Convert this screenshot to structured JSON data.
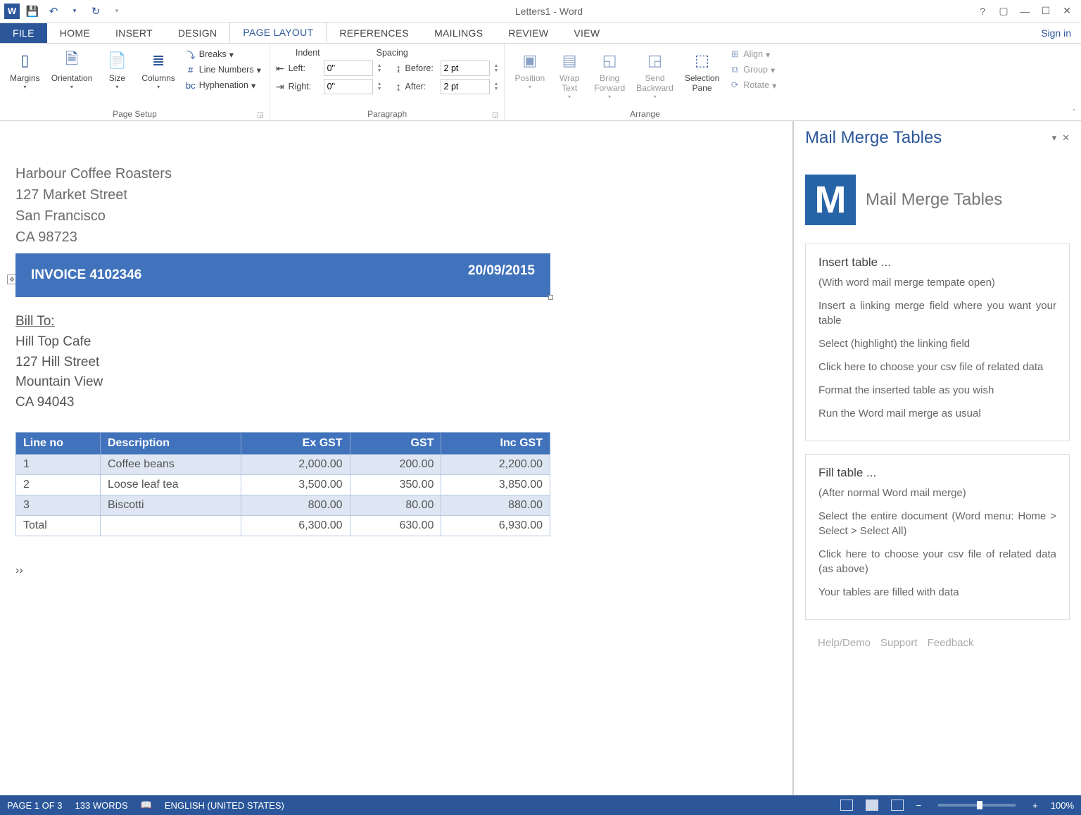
{
  "title": "Letters1 - Word",
  "signin": "Sign in",
  "tabs": [
    "FILE",
    "HOME",
    "INSERT",
    "DESIGN",
    "PAGE LAYOUT",
    "REFERENCES",
    "MAILINGS",
    "REVIEW",
    "VIEW"
  ],
  "active_tab": "PAGE LAYOUT",
  "ribbon": {
    "page_setup": {
      "label": "Page Setup",
      "margins": "Margins",
      "orientation": "Orientation",
      "size": "Size",
      "columns": "Columns",
      "breaks": "Breaks",
      "line_numbers": "Line Numbers",
      "hyphenation": "Hyphenation"
    },
    "paragraph": {
      "label": "Paragraph",
      "indent_head": "Indent",
      "spacing_head": "Spacing",
      "left_lbl": "Left:",
      "right_lbl": "Right:",
      "before_lbl": "Before:",
      "after_lbl": "After:",
      "left_val": "0\"",
      "right_val": "0\"",
      "before_val": "2 pt",
      "after_val": "2 pt"
    },
    "arrange": {
      "label": "Arrange",
      "position": "Position",
      "wrap": "Wrap\nText",
      "forward": "Bring\nForward",
      "backward": "Send\nBackward",
      "selpane": "Selection\nPane",
      "align": "Align",
      "group": "Group",
      "rotate": "Rotate"
    }
  },
  "doc": {
    "sender": [
      "Harbour Coffee Roasters",
      "127 Market Street",
      "San Francisco",
      "CA 98723"
    ],
    "invoice_no": "INVOICE 4102346",
    "invoice_date": "20/09/2015",
    "billto_label": "Bill To:",
    "billto": [
      "Hill Top Cafe",
      "127 Hill Street",
      "Mountain View",
      "CA 94043"
    ],
    "table": {
      "headers": [
        "Line no",
        "Description",
        "Ex GST",
        "GST",
        "Inc GST"
      ],
      "rows": [
        [
          "1",
          "Coffee beans",
          "2,000.00",
          "200.00",
          "2,200.00"
        ],
        [
          "2",
          "Loose leaf tea",
          "3,500.00",
          "350.00",
          "3,850.00"
        ],
        [
          "3",
          "Biscotti",
          "800.00",
          "80.00",
          "880.00"
        ],
        [
          "Total",
          "",
          "6,300.00",
          "630.00",
          "6,930.00"
        ]
      ]
    },
    "nextrec": "››"
  },
  "pane": {
    "title": "Mail Merge Tables",
    "logo_title": "Mail Merge Tables",
    "card1_h": "Insert table ...",
    "card1_p": [
      "(With word mail merge tempate open)",
      "Insert a linking merge field where you want your table",
      "Select (highlight) the linking field",
      "Click here to choose your csv file of related data",
      "Format the inserted table as you wish",
      "Run the Word mail merge as usual"
    ],
    "card2_h": "Fill table ...",
    "card2_p": [
      "(After normal Word mail merge)",
      "Select the entire document (Word menu: Home > Select > Select All)",
      "Click here to choose your csv file of related data (as above)",
      "Your tables are filled with data"
    ],
    "links": [
      "Help/Demo",
      "Support",
      "Feedback"
    ]
  },
  "status": {
    "page": "PAGE 1 OF 3",
    "words": "133 WORDS",
    "lang": "ENGLISH (UNITED STATES)",
    "zoom": "100%"
  }
}
